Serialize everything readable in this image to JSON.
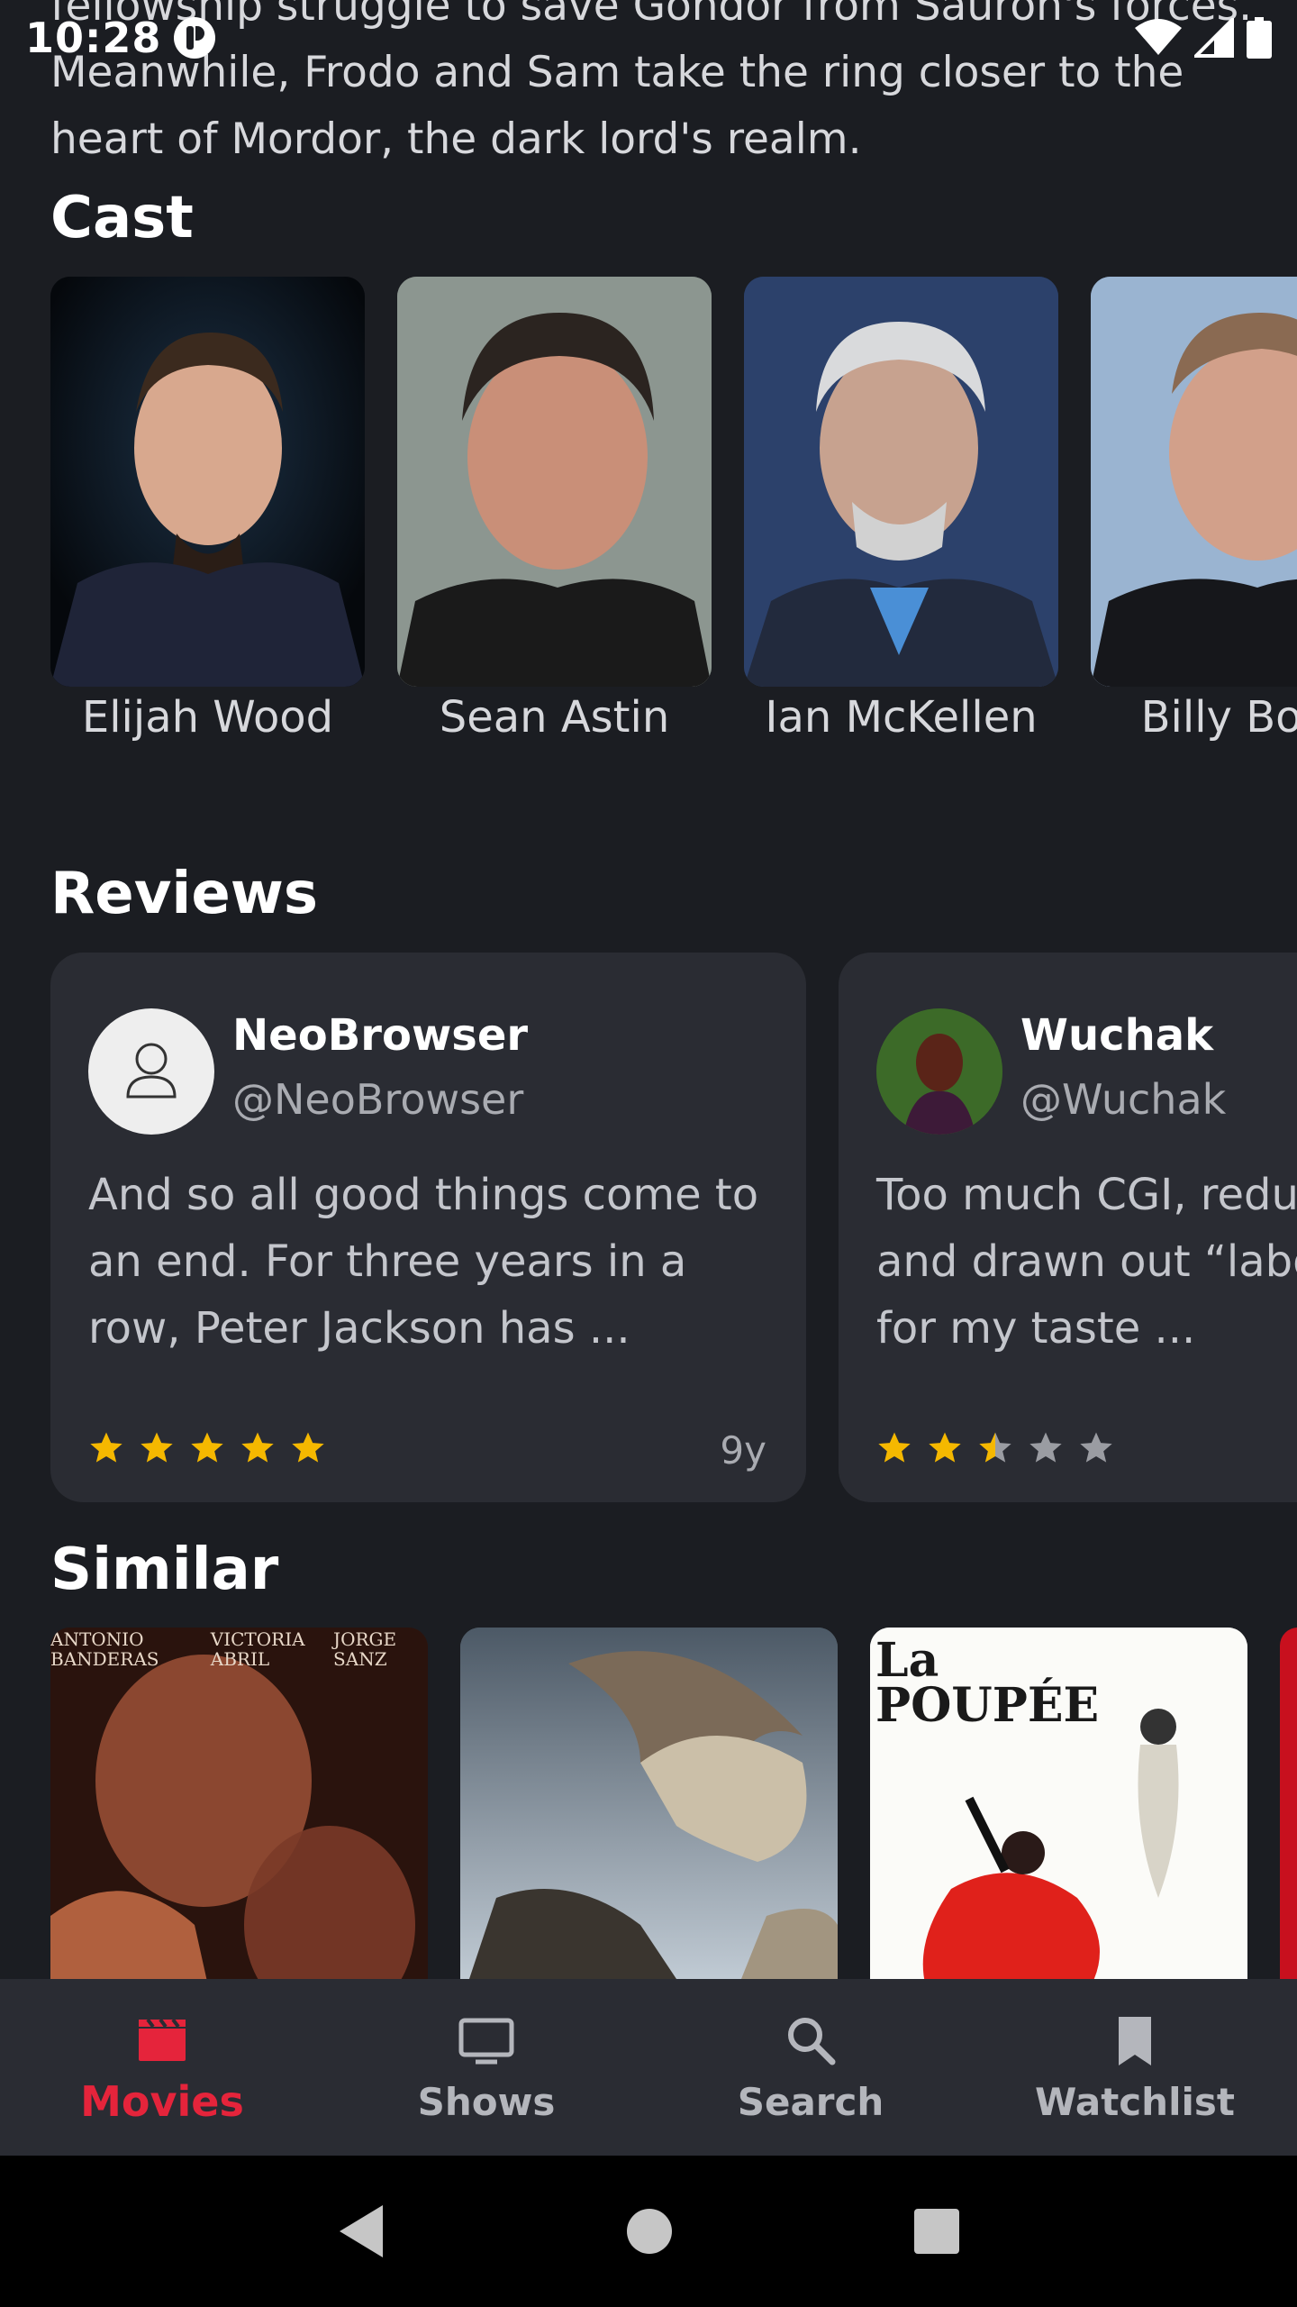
{
  "status_bar": {
    "time": "10:28"
  },
  "overview": {
    "text": "fellowship struggle to save Gondor from Sauron's forces. Meanwhile, Frodo and Sam take the ring closer to the heart of Mordor, the dark lord's realm."
  },
  "sections": {
    "cast_title": "Cast",
    "reviews_title": "Reviews",
    "similar_title": "Similar"
  },
  "cast": [
    {
      "name": "Elijah Wood"
    },
    {
      "name": "Sean Astin"
    },
    {
      "name": "Ian McKellen"
    },
    {
      "name": "Billy Boyd"
    }
  ],
  "reviews": [
    {
      "name": "NeoBrowser",
      "handle": "@NeoBrowser",
      "text": "And so all good things come to an end. For three years in a row, Peter Jackson has ...",
      "rating": 5,
      "age": "9y"
    },
    {
      "name": "Wuchak",
      "handle": "@Wuchak",
      "text": "Too much CGI, reduced clichés and drawn out “labor of love” for my taste ...",
      "rating": 2.5,
      "age": ""
    }
  ],
  "similar_posters": [
    {
      "credits": [
        "ANTONIO BANDERAS",
        "VICTORIA ABRIL",
        "JORGE SANZ"
      ]
    },
    {
      "credits": []
    },
    {
      "title": "La POUPÉE"
    }
  ],
  "bottom_nav": {
    "items": [
      {
        "label": "Movies",
        "icon": "clapperboard-icon",
        "active": true
      },
      {
        "label": "Shows",
        "icon": "tv-icon",
        "active": false
      },
      {
        "label": "Search",
        "icon": "search-icon",
        "active": false
      },
      {
        "label": "Watchlist",
        "icon": "bookmark-icon",
        "active": false
      }
    ]
  },
  "colors": {
    "background": "#1b1d22",
    "card": "#2a2c33",
    "accent": "#e5243b",
    "star": "#f5b800",
    "star_empty": "#9a9ca2"
  }
}
